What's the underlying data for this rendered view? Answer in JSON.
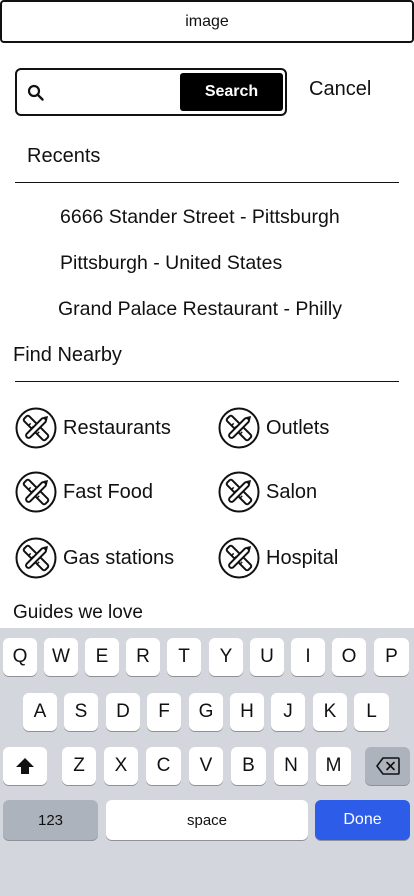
{
  "header": {
    "title": "image"
  },
  "search": {
    "placeholder": "",
    "value": "",
    "button_label": "Search",
    "cancel_label": "Cancel"
  },
  "recents": {
    "title": "Recents",
    "items": [
      "6666 Stander Street - Pittsburgh",
      "Pittsburgh - United States",
      "Grand Palace Restaurant - Philly"
    ]
  },
  "nearby": {
    "title": "Find Nearby",
    "items": [
      {
        "label": "Restaurants",
        "icon": "restaurant-icon"
      },
      {
        "label": "Outlets",
        "icon": "outlet-icon"
      },
      {
        "label": "Fast Food",
        "icon": "fast-food-icon"
      },
      {
        "label": "Salon",
        "icon": "salon-icon"
      },
      {
        "label": "Gas stations",
        "icon": "gas-station-icon"
      },
      {
        "label": "Hospital",
        "icon": "hospital-icon"
      }
    ]
  },
  "guides": {
    "title": "Guides we love"
  },
  "keyboard": {
    "row1": [
      "Q",
      "W",
      "E",
      "R",
      "T",
      "Y",
      "U",
      "I",
      "O",
      "P"
    ],
    "row2": [
      "A",
      "S",
      "D",
      "F",
      "G",
      "H",
      "J",
      "K",
      "L"
    ],
    "row3": [
      "Z",
      "X",
      "C",
      "V",
      "B",
      "N",
      "M"
    ],
    "numbers_label": "123",
    "space_label": "space",
    "done_label": "Done",
    "shift_icon": "shift-icon",
    "delete_icon": "backspace-icon",
    "done_color": "#2d5ce8"
  }
}
